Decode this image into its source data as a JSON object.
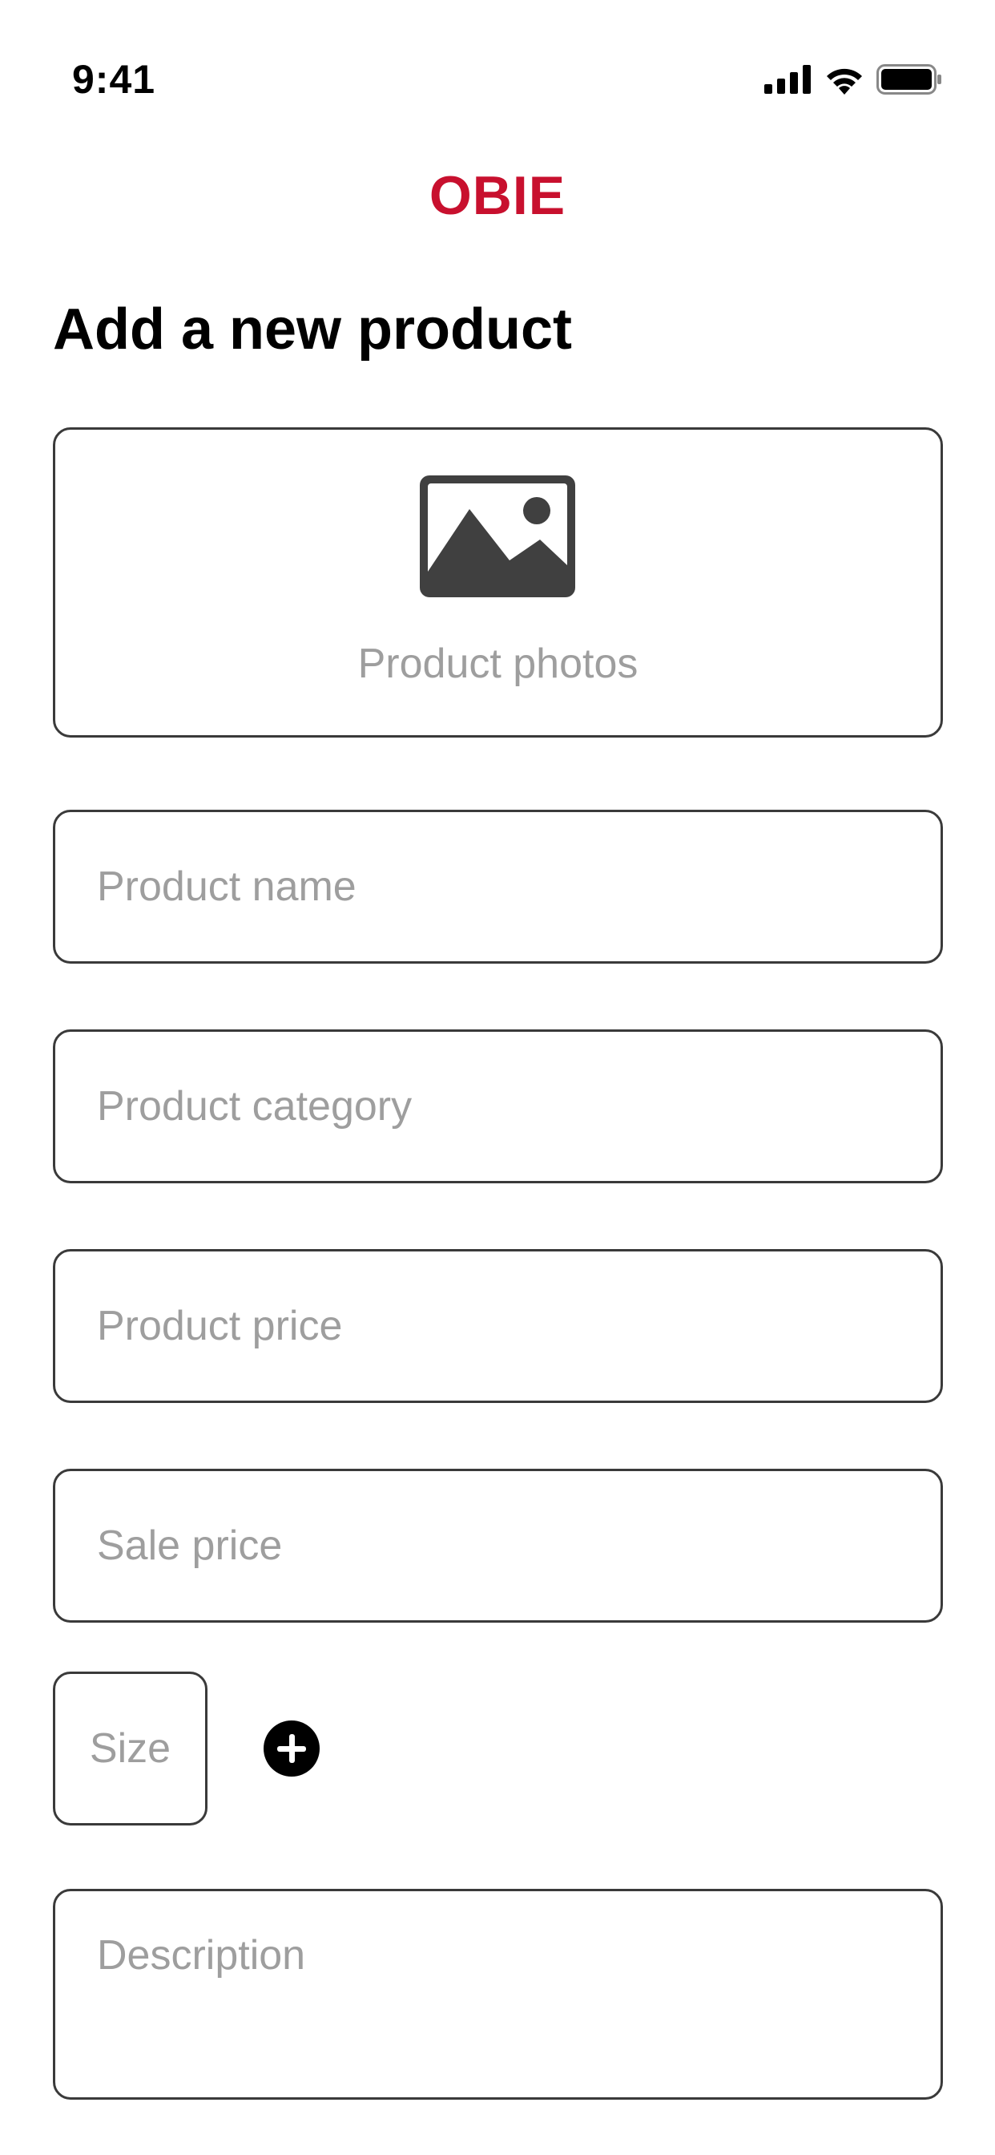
{
  "status_bar": {
    "time": "9:41",
    "icons": [
      "cellular-signal-icon",
      "wifi-icon",
      "battery-icon"
    ]
  },
  "header": {
    "brand": "OBIE",
    "brand_color": "#c8102e"
  },
  "page": {
    "title": "Add a new product"
  },
  "form": {
    "photos": {
      "icon": "image-icon",
      "label": "Product photos"
    },
    "product_name": {
      "placeholder": "Product name",
      "value": ""
    },
    "product_category": {
      "placeholder": "Product category",
      "value": ""
    },
    "product_price": {
      "placeholder": "Product price",
      "value": ""
    },
    "sale_price": {
      "placeholder": "Sale price",
      "value": ""
    },
    "size": {
      "placeholder": "Size",
      "value": ""
    },
    "add_size": {
      "icon": "plus-circle-icon"
    },
    "description": {
      "placeholder": "Description",
      "value": ""
    }
  }
}
